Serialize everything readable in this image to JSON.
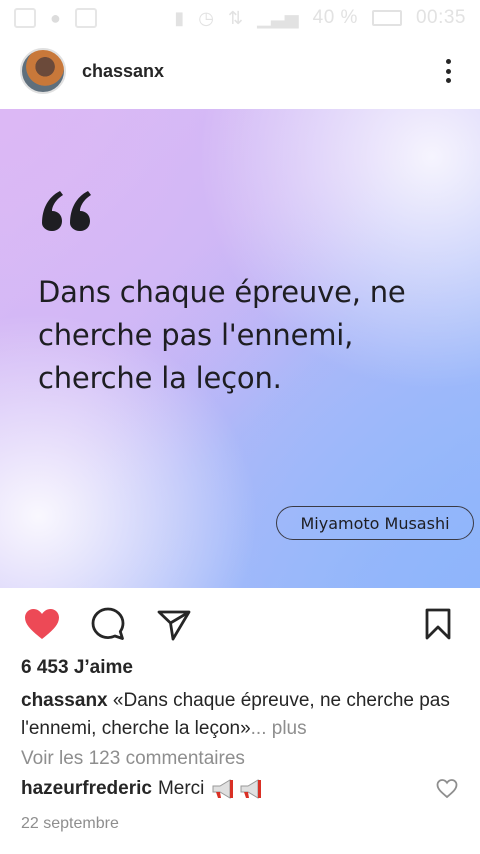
{
  "status_bar": {
    "battery": "40 %",
    "time": "00:35"
  },
  "post": {
    "username": "chassanx",
    "image": {
      "quote": "Dans chaque épreuve, ne cherche pas l'ennemi, cherche la leçon.",
      "author": "Miyamoto Musashi"
    },
    "likes_text": "6 453 J’aime",
    "caption_user": "chassanx",
    "caption_text": "«Dans chaque épreuve, ne cherche pas l'ennemi, cherche la leçon»",
    "caption_more": "... plus",
    "view_comments": "Voir les 123 commentaires",
    "comment": {
      "user": "hazeurfrederic",
      "text": "Merci"
    },
    "date": "22 septembre"
  },
  "icons": {
    "like": "heart-filled-icon",
    "comment": "comment-bubble-icon",
    "share": "paper-plane-icon",
    "save": "bookmark-icon",
    "more": "vertical-dots-icon",
    "comment_like": "heart-outline-icon",
    "emoji": "megaphone-emoji"
  },
  "colors": {
    "like_red": "#ed4956",
    "text": "#262626",
    "muted": "#8e8e8e"
  }
}
